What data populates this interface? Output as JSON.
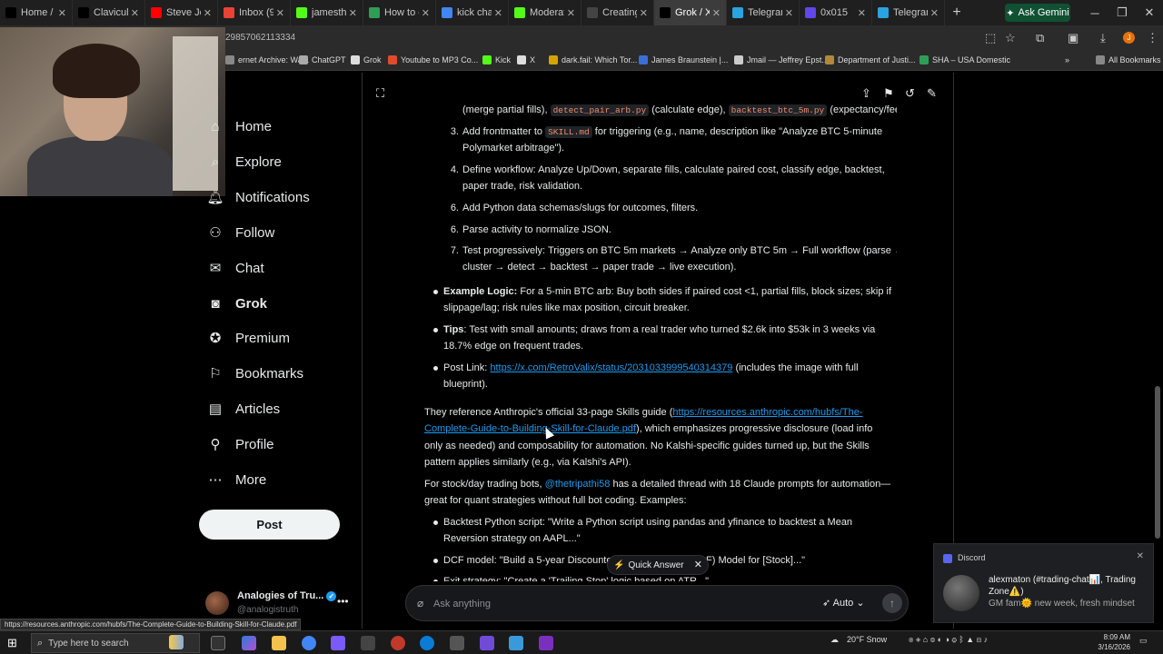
{
  "browser": {
    "tabs": [
      {
        "title": "Home / X",
        "icon": "x-icon",
        "color": "#000000"
      },
      {
        "title": "Clavicula",
        "icon": "x-icon",
        "color": "#000000"
      },
      {
        "title": "Steve Joi",
        "icon": "youtube-icon",
        "color": "#ff0000"
      },
      {
        "title": "Inbox (9)",
        "icon": "gmail-icon",
        "color": "#ea4335"
      },
      {
        "title": "jamesthe",
        "icon": "kick-icon",
        "color": "#53fc18"
      },
      {
        "title": "How to c",
        "icon": "green-icon",
        "color": "#2e9e57"
      },
      {
        "title": "kick chat",
        "icon": "google-icon",
        "color": "#4285f4"
      },
      {
        "title": "Moderat",
        "icon": "kick-icon",
        "color": "#53fc18"
      },
      {
        "title": "Creating",
        "icon": "chatgpt-icon",
        "color": "#444444"
      },
      {
        "title": "Grok / X",
        "icon": "x-icon",
        "color": "#000000",
        "active": true
      },
      {
        "title": "Telegram",
        "icon": "telegram-icon",
        "color": "#2aa3e0"
      },
      {
        "title": "0x015",
        "icon": "purple-icon",
        "color": "#6246ea"
      },
      {
        "title": "Telegram",
        "icon": "telegram-icon",
        "color": "#2aa3e0"
      }
    ],
    "ask_gemini": "Ask Gemini",
    "url_fragment": "29857062113334",
    "bookmarks": [
      {
        "label": "ernet Archive: Wa...",
        "color": "#888888"
      },
      {
        "label": "ChatGPT",
        "color": "#aaaaaa"
      },
      {
        "label": "Grok",
        "color": "#dddddd"
      },
      {
        "label": "Youtube to MP3 Co...",
        "color": "#e04b2b"
      },
      {
        "label": "Kick",
        "color": "#53fc18"
      },
      {
        "label": "X",
        "color": "#dddddd"
      },
      {
        "label": "dark.fail: Which Tor...",
        "color": "#d6a400"
      },
      {
        "label": "James Braunstein |...",
        "color": "#3b6fd8"
      },
      {
        "label": "Jmail — Jeffrey Epst...",
        "color": "#cccccc"
      },
      {
        "label": "Department of Justi...",
        "color": "#b08a3a"
      },
      {
        "label": "SHA – USA Domestic",
        "color": "#2e9e57"
      }
    ],
    "all_bookmarks": "All Bookmarks",
    "status_url": "https://resources.anthropic.com/hubfs/The-Complete-Guide-to-Building-Skill-for-Claude.pdf"
  },
  "sidebar": {
    "items": [
      {
        "label": "Home",
        "icon": "home-icon"
      },
      {
        "label": "Explore",
        "icon": "search-icon"
      },
      {
        "label": "Notifications",
        "icon": "bell-icon"
      },
      {
        "label": "Follow",
        "icon": "follow-icon"
      },
      {
        "label": "Chat",
        "icon": "mail-icon"
      },
      {
        "label": "Grok",
        "icon": "grok-icon",
        "active": true
      },
      {
        "label": "Premium",
        "icon": "premium-icon"
      },
      {
        "label": "Bookmarks",
        "icon": "bookmark-icon"
      },
      {
        "label": "Articles",
        "icon": "article-icon"
      },
      {
        "label": "Profile",
        "icon": "person-icon"
      },
      {
        "label": "More",
        "icon": "more-icon"
      }
    ],
    "post_label": "Post",
    "account": {
      "name": "Analogies of Tru...",
      "handle": "@analogistruth"
    }
  },
  "grok": {
    "line_top": {
      "pre": "(merge partial fills), ",
      "code1": "detect_pair_arb.py",
      "mid": " (calculate edge), ",
      "code2": "backtest_btc_5m.py",
      "post": " (expectancy/fees)."
    },
    "steps": {
      "s3": {
        "num": "3.",
        "pre": "Add frontmatter to ",
        "code": "SKILL.md",
        "l1": " for triggering (e.g., name, description like \"Analyze BTC 5-minute",
        "l2": "Polymarket arbitrage\")."
      },
      "s4": {
        "num": "4.",
        "l1": "Define workflow: Analyze Up/Down, separate fills, calculate paired cost, classify edge, backtest,",
        "l2": "paper trade, risk validation."
      },
      "s6": {
        "num": "6.",
        "l1": "Add Python data schemas/slugs for outcomes, filters."
      },
      "s6b": {
        "num": "6.",
        "l1": "Parse activity to normalize JSON."
      },
      "s7": {
        "num": "7.",
        "l1": "Test progressively: Triggers on BTC 5m markets → Analyze only BTC 5m → Full workflow (parse →",
        "l2": "cluster → detect → backtest → paper trade → live execution)."
      }
    },
    "bullets": {
      "logic": {
        "bold": "Example Logic:",
        "l1": " For a 5-min BTC arb: Buy both sides if paired cost <1, partial fills, block sizes; skip if",
        "l2": "slippage/lag; risk rules like max position, circuit breaker."
      },
      "tips": {
        "bold": "Tips",
        "l1": ": Test with small amounts; draws from a real trader who turned $2.6k into $53k in 3 weeks via",
        "l2": "18.7% edge on frequent trades."
      },
      "post": {
        "pre": "Post Link: ",
        "link": "https://x.com/RetroValix/status/2031033999540314379",
        "post": " (includes the image with full",
        "l2": "blueprint)."
      }
    },
    "para1": {
      "pre": "They reference Anthropic's official 33-page Skills guide (",
      "link1": "https://resources.anthropic.com/hubfs/The-",
      "link2": "Complete-Guide-to-Building-Skill-for-Claude.pdf",
      "post1": "), which emphasizes progressive disclosure (load info",
      "l3": "only as needed) and composability for automation. No Kalshi-specific guides turned up, but the Skills",
      "l4": "pattern applies similarly (e.g., via Kalshi's API)."
    },
    "para2": {
      "pre": "For stock/day trading bots, ",
      "mention": "@thetripathi58",
      "post": " has a detailed thread with 18 Claude prompts for automation—",
      "l2": "great for quant strategies without full bot coding. Examples:"
    },
    "examples": {
      "e1": {
        "l1": "Backtest Python script: \"Write a Python script using pandas and yfinance to backtest a Mean",
        "l2": "Reversion strategy on AAPL...\""
      },
      "e2": {
        "l1": "DCF model: \"Build a 5-year Discounte",
        "l1b": "F) Model for [Stock]...\""
      },
      "e3": {
        "l1": "Exit strategy: \"Create a 'Trailing Stop' logic based on ATR...\""
      }
    },
    "quick_answer": "Quick Answer",
    "ask_placeholder": "Ask anything",
    "mode": "Auto"
  },
  "notification": {
    "app": "Discord",
    "title": "alexmaton (#trading-chat📊, Trading Zone⚠️)",
    "message": "GM fam🌞 new week, fresh mindset"
  },
  "taskbar": {
    "search_placeholder": "Type here to search",
    "weather": "20°F  Snow",
    "time": "8:09 AM",
    "date": "3/16/2026"
  }
}
